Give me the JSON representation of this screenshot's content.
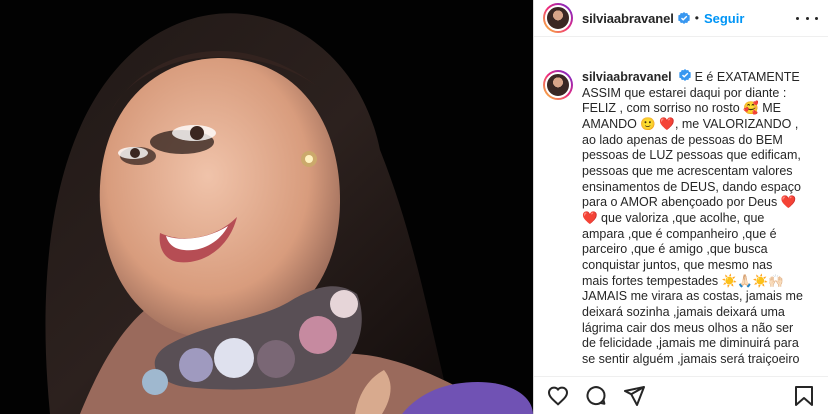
{
  "post": {
    "username": "silviaabravanel",
    "follow_label": "Seguir",
    "caption_lines": [
      "E é EXATAMENTE",
      "ASSIM que estarei daqui por diante :",
      "FELIZ , com sorriso no rosto 🥰 ME",
      "AMANDO 🙂 ❤️, me VALORIZANDO ,",
      "ao lado apenas de pessoas do BEM",
      "pessoas de LUZ pessoas que edificam,",
      "pessoas que me acrescentam valores",
      "ensinamentos de DEUS, dando espaço",
      "para o AMOR abençoado por Deus ❤️",
      "❤️ que valoriza ,que acolhe, que",
      "ampara ,que é companheiro ,que é",
      "parceiro ,que é amigo ,que busca",
      "conquistar juntos, que mesmo nas",
      "mais fortes tempestades ☀️🙏🏻☀️🙌🏻",
      "JAMAIS me virara as costas, jamais me",
      "deixará sozinha ,jamais deixará uma",
      "lágrima cair dos meus olhos a não ser",
      "de felicidade ,jamais me diminuirá para",
      "se sentir alguém ,jamais será traiçoeiro"
    ]
  },
  "icons": {
    "verified": "verified-badge-icon",
    "more": "more-options-icon",
    "like": "heart-icon",
    "comment": "comment-icon",
    "share": "share-icon",
    "save": "bookmark-icon"
  },
  "colors": {
    "accent": "#0095f6",
    "text": "#262626",
    "border": "#dbdbdb"
  }
}
